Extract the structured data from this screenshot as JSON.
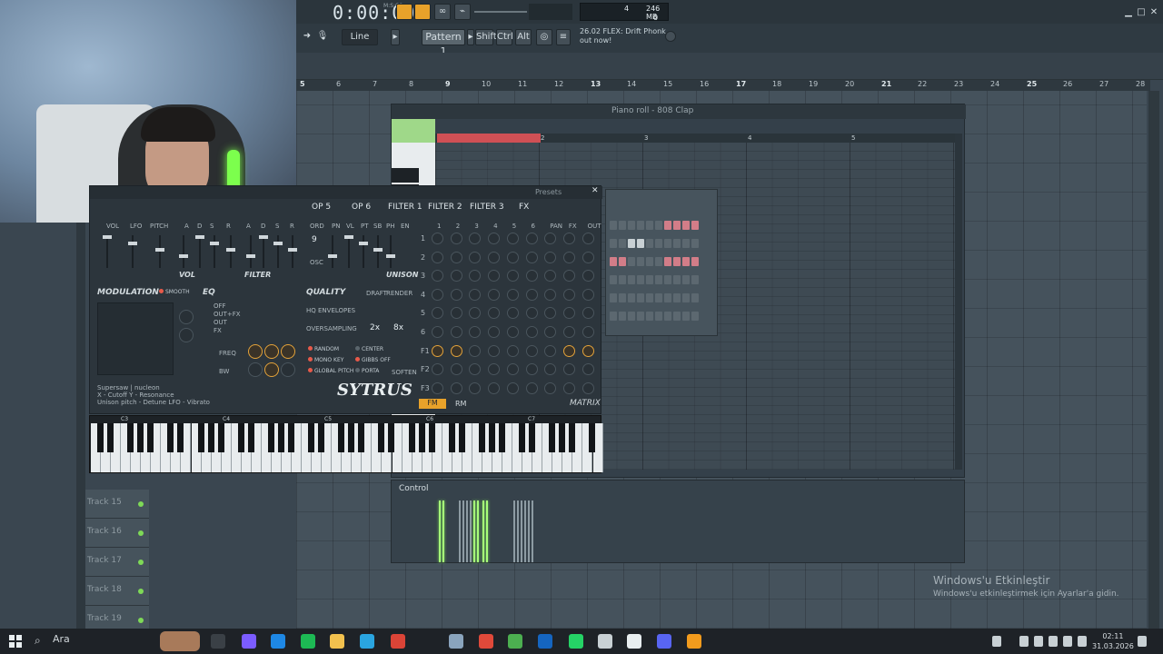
{
  "transport": {
    "time": "0:00:00",
    "time_label": "M:S:CS",
    "mode_label": "Line",
    "pattern": "Pattern 1",
    "shift": "Shift",
    "ctrl": "Ctrl",
    "alt": "Alt"
  },
  "news": {
    "line1": "26.02  FLEX: Drift Phonk",
    "line2": "out now!"
  },
  "cpu": {
    "val1": "4",
    "val2": "246 MB",
    "val3": "0"
  },
  "ruler": [
    "5",
    "6",
    "7",
    "8",
    "9",
    "10",
    "11",
    "12",
    "13",
    "14",
    "15",
    "16",
    "17",
    "18",
    "19",
    "20",
    "21",
    "22",
    "23",
    "24",
    "25",
    "26",
    "27",
    "28"
  ],
  "tracks": [
    "Track 15",
    "Track 16",
    "Track 17",
    "Track 18",
    "Track 19"
  ],
  "piano_roll": {
    "title": "Piano roll - 808 Clap",
    "bars": [
      "2",
      "3",
      "4",
      "5"
    ]
  },
  "sytrus": {
    "presets": "Presets",
    "tabs": [
      "OP 5",
      "OP 6",
      "FILTER 1",
      "FILTER 2",
      "FILTER 3",
      "FX"
    ],
    "op_labels": [
      "VOL",
      "LFO",
      "PITCH",
      "A",
      "D",
      "S",
      "R",
      "A",
      "D",
      "S",
      "R"
    ],
    "ord_labels": [
      "ORD",
      "PN",
      "VL",
      "PT",
      "SB",
      "PH",
      "EN"
    ],
    "ord_value": "9",
    "osc": "OSC",
    "vol_label": "VOL",
    "filter_label": "FILTER",
    "unison_label": "UNISON",
    "modulation": "MODULATION",
    "smooth": "SMOOTH",
    "eq": "EQ",
    "eq_modes": [
      "OFF",
      "OUT+FX",
      "OUT",
      "FX"
    ],
    "freq": "FREQ",
    "bw": "BW",
    "quality": "QUALITY",
    "draft": "DRAFT",
    "render": "RENDER",
    "hq_env": "HQ ENVELOPES",
    "oversampling": "OVERSAMPLING",
    "os_2x": "2x",
    "os_8x": "8x",
    "opts_left": [
      "RANDOM",
      "MONO KEY",
      "GLOBAL PITCH"
    ],
    "opts_right": [
      "CENTER",
      "GIBBS OFF",
      "PORTA"
    ],
    "soften": "SOFTEN",
    "matrix_cols": [
      "1",
      "2",
      "3",
      "4",
      "5",
      "6",
      "PAN",
      "FX",
      "OUT"
    ],
    "matrix_rows": [
      "1",
      "2",
      "3",
      "4",
      "5",
      "6",
      "F1",
      "F2",
      "F3"
    ],
    "fm": "FM",
    "rm": "RM",
    "matrix": "MATRIX",
    "logo": "SYTRUS",
    "preset_info": [
      "Supersaw   | nucleon",
      "X - Cutoff  Y - Resonance",
      "Unison pitch - Detune  LFO - Vibrato"
    ]
  },
  "keyboard": {
    "octaves": [
      "C3",
      "C4",
      "C5",
      "C6",
      "C7"
    ]
  },
  "control": {
    "label": "Control"
  },
  "watermark": {
    "line1": "Windows'u Etkinleştir",
    "line2": "Windows'u etkinleştirmek için Ayarlar'a gidin."
  },
  "taskbar": {
    "search": "Ara",
    "time": "02:11",
    "date": "31.03.2026"
  }
}
